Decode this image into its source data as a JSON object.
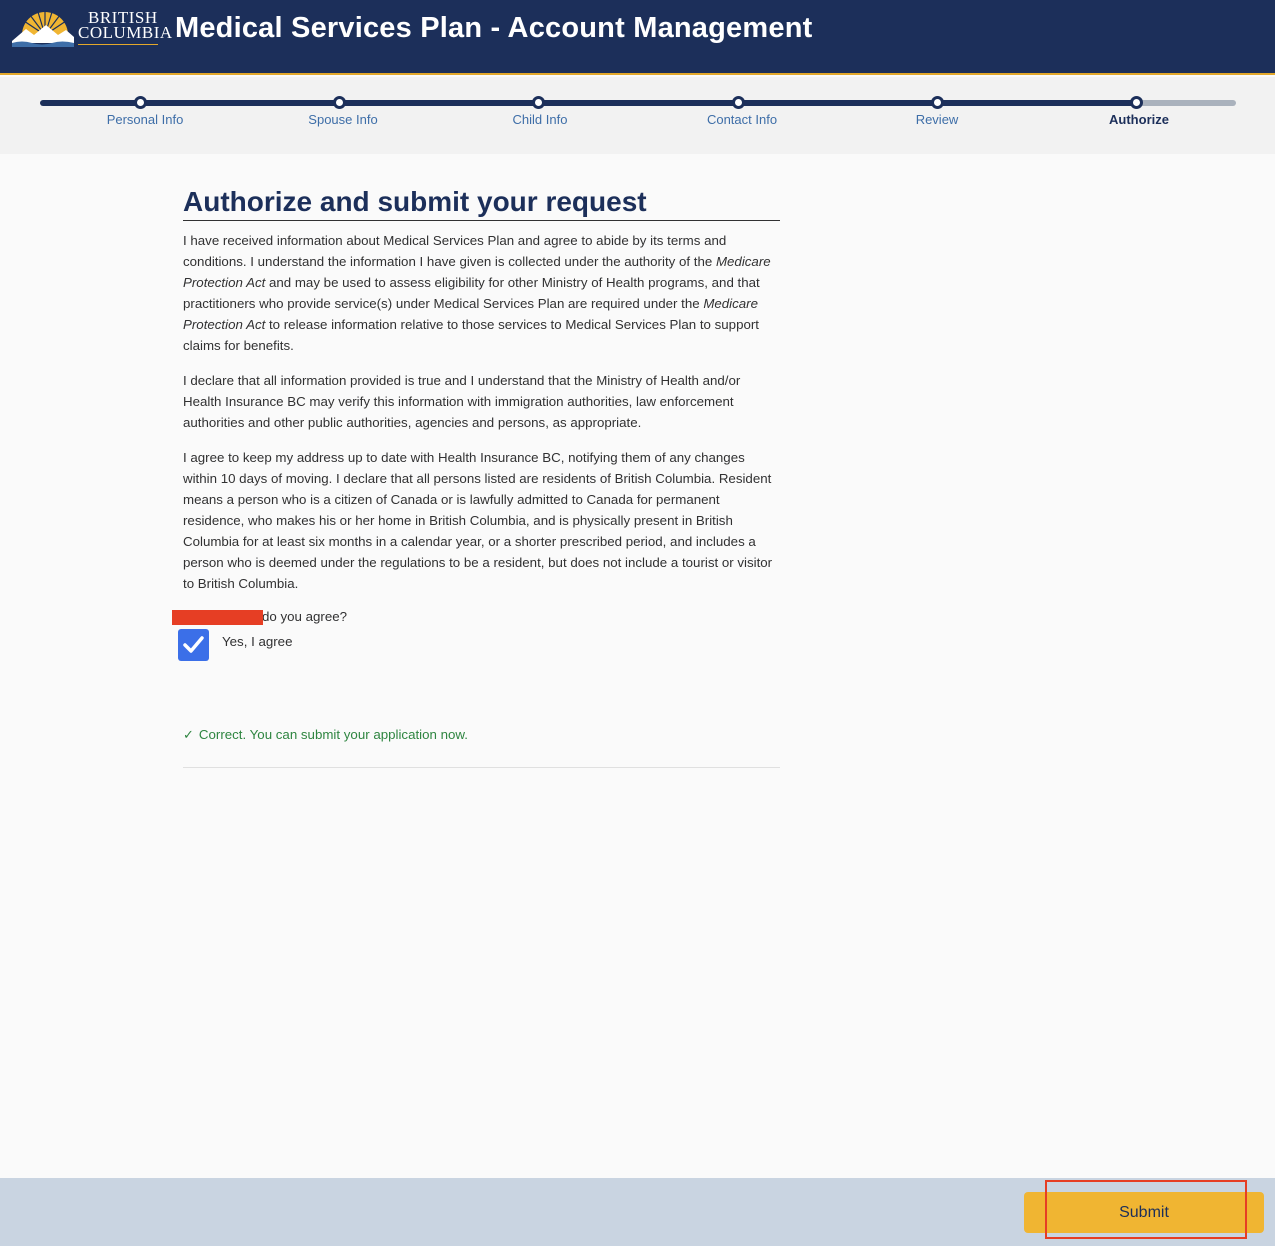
{
  "header": {
    "logo_line1": "BRITISH",
    "logo_line2": "COLUMBIA",
    "title": "Medical Services Plan - Account Management"
  },
  "progress": {
    "steps": [
      {
        "label": "Personal Info"
      },
      {
        "label": "Spouse Info"
      },
      {
        "label": "Child Info"
      },
      {
        "label": "Contact Info"
      },
      {
        "label": "Review"
      },
      {
        "label": "Authorize"
      }
    ],
    "current_step": 6
  },
  "main": {
    "title": "Authorize and submit your request",
    "para1": {
      "a": "I have received information about Medical Services Plan and agree to abide by its terms and conditions. I understand the information I have given is collected under the authority of the ",
      "act1": "Medicare Protection Act",
      "b": " and may be used to assess eligibility for other Ministry of Health programs, and that practitioners who provide service(s) under Medical Services Plan are required under the ",
      "act2": "Medicare Protection Act",
      "c": " to release information relative to those services to Medical Services Plan to support claims for benefits."
    },
    "para2": "I declare that all information provided is true and I understand that the Ministry of Health and/or Health Insurance BC may verify this information with immigration authorities, law enforcement authorities and other public authorities, agencies and persons, as appropriate.",
    "para3": "I agree to keep my address up to date with Health Insurance BC, notifying them of any changes within 10 days of moving. I declare that all persons listed are residents of British Columbia. Resident means a person who is a citizen of Canada or is lawfully admitted to Canada for permanent residence, who makes his or her home in British Columbia, and is physically present in British Columbia for at least six months in a calendar year, or a shorter prescribed period, and includes a person who is deemed under the regulations to be a resident, but does not include a tourist or visitor to British Columbia.",
    "question": "do you agree?",
    "checkbox_label": "Yes, I agree",
    "checkbox_checked": true,
    "success_message": "Correct. You can submit your application now."
  },
  "footer": {
    "submit_label": "Submit"
  },
  "colors": {
    "header_bg": "#1c2f5a",
    "accent_gold": "#f0b532",
    "success_green": "#2e8540",
    "checkbox_blue": "#3b6fe8",
    "annotation_red": "#e63e24"
  }
}
